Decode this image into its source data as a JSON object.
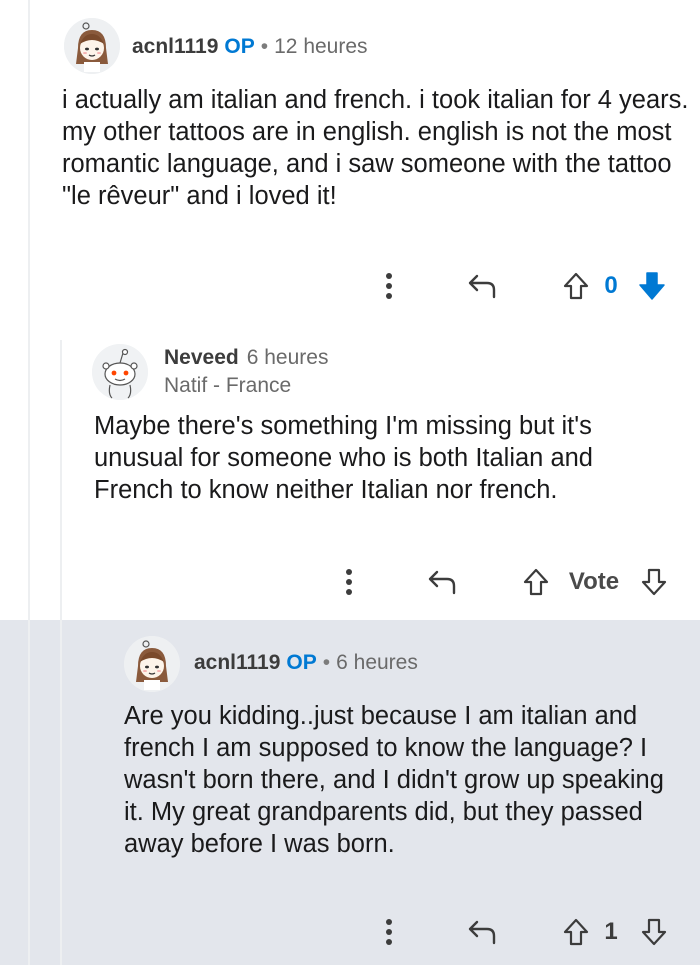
{
  "comments": [
    {
      "author": "acnl1119",
      "op_badge": "OP",
      "separator": "•",
      "time": "12 heures",
      "body": "i actually am italian and french. i took italian for 4 years. my other tattoos are in english. english is not the most romantic language, and i saw someone with the tattoo \"le rêveur\" and i loved it!",
      "score": "0",
      "icons": [
        "more-icon",
        "reply-icon",
        "upvote-icon",
        "downvote-icon"
      ],
      "downvote_active_color": "#0079d3"
    },
    {
      "author": "Neveed",
      "time": "6 heures",
      "flair": "Natif - France",
      "body": "Maybe there's something I'm missing but it's unusual for someone who is both Italian and French to know neither Italian nor french.",
      "vote_label": "Vote",
      "icons": [
        "more-icon",
        "reply-icon",
        "upvote-icon",
        "downvote-icon"
      ]
    },
    {
      "author": "acnl1119",
      "op_badge": "OP",
      "separator": "•",
      "time": "6 heures",
      "body": "Are you kidding..just because I am italian and french I am supposed to know the language? I wasn't born there, and I didn't grow up speaking it. My great grandparents did, but they passed away before I was born.",
      "score": "1",
      "icons": [
        "more-icon",
        "reply-icon",
        "upvote-icon",
        "downvote-icon"
      ],
      "highlight_color": "#e3e6ec"
    }
  ]
}
